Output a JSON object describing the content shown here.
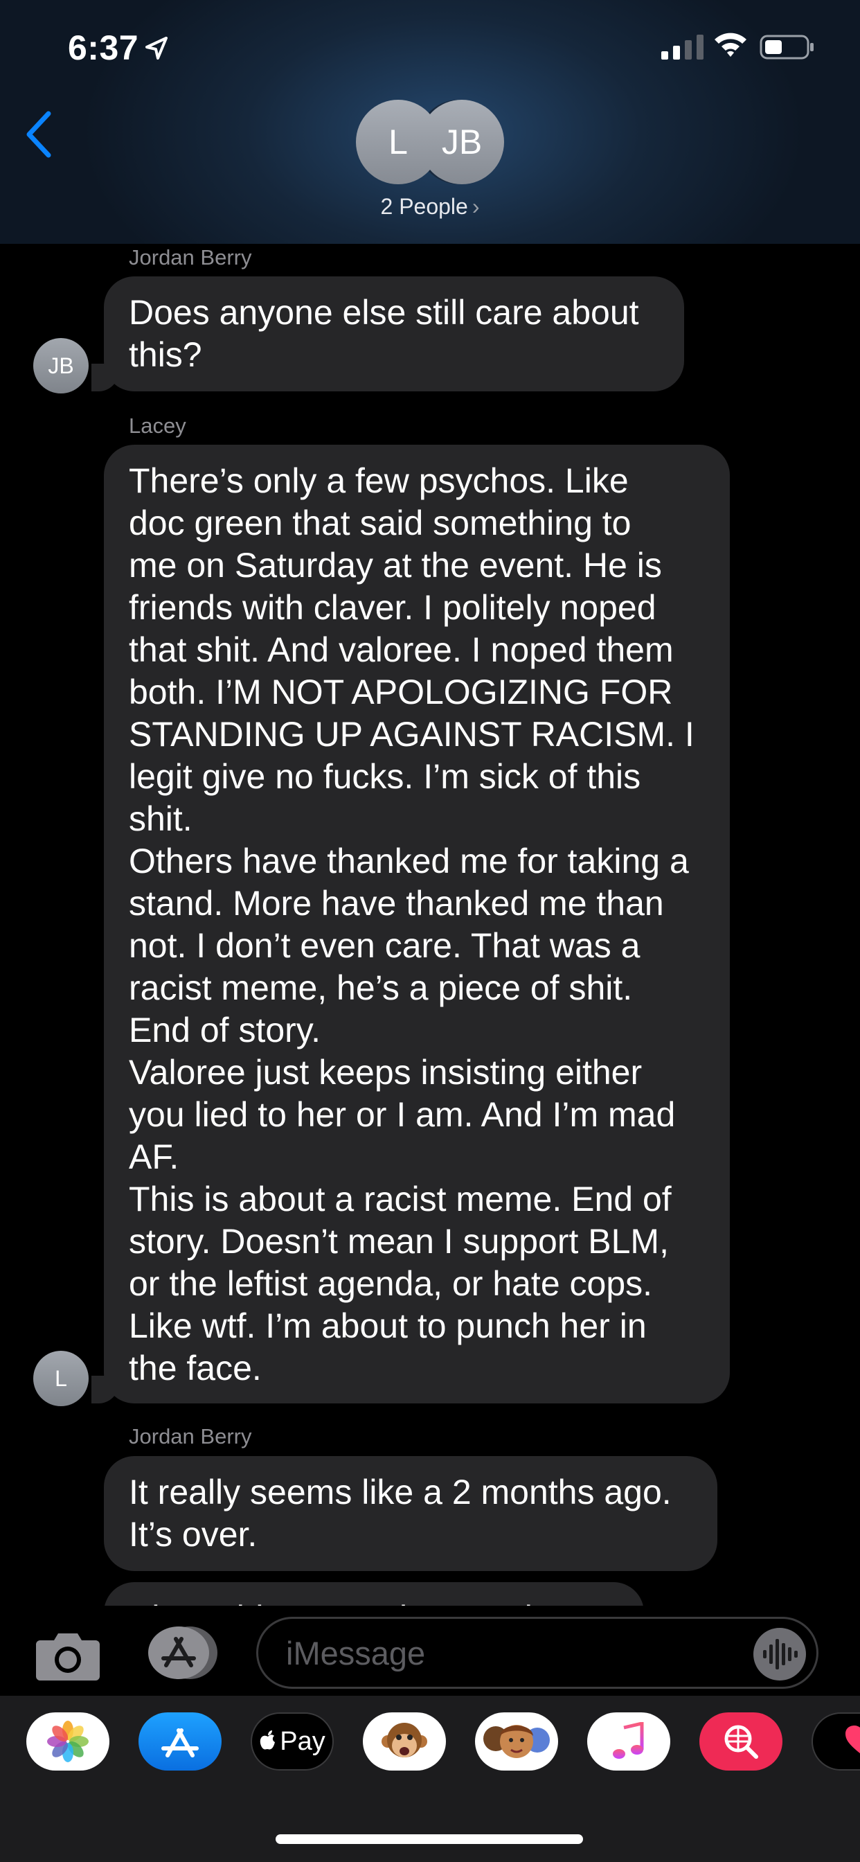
{
  "status_bar": {
    "time": "6:37"
  },
  "header": {
    "avatars": [
      "L",
      "JB"
    ],
    "title": "2 People",
    "chevron": "›"
  },
  "messages": [
    {
      "sender": "Jordan Berry",
      "avatar": "JB",
      "lines": [
        "Does anyone else still care about",
        "this?"
      ]
    },
    {
      "sender": "Lacey",
      "avatar": "L",
      "lines": [
        "There’s only a few psychos. Like",
        "doc green that said something to",
        "me on Saturday at the event. He is",
        "friends with claver. I politely noped",
        "that shit. And valoree. I noped them",
        "both. I’M NOT APOLOGIZING FOR",
        "STANDING UP AGAINST RACISM. I",
        "legit give no fucks. I’m sick of this",
        "shit.",
        "Others have thanked me for taking a",
        "stand. More have thanked me than",
        "not. I don’t even care. That was a",
        "racist meme, he’s a piece of shit.",
        "End of story.",
        "Valoree just keeps insisting either",
        "you lied to her or I am. And I’m mad",
        "AF.",
        "This is about a racist meme. End of",
        "story. Doesn’t mean I support BLM,",
        "or the leftist agenda, or hate cops.",
        "Like wtf. I’m about to punch her in",
        "the face."
      ]
    },
    {
      "sender": "Jordan Berry",
      "lines": [
        "It really seems like a 2 months ago.",
        "It’s over."
      ]
    },
    {
      "partial_text": "Blame him. He’s the one that’s"
    }
  ],
  "input": {
    "placeholder": "iMessage"
  },
  "app_drawer": {
    "apps": [
      "photos-app",
      "app-store-app",
      "apple-pay-app",
      "animoji-app",
      "memoji-app",
      "music-app",
      "web-images-app",
      "digital-touch-app"
    ],
    "apple_pay_label": "Pay"
  },
  "colors": {
    "accent": "#0a84ff",
    "bubble": "#262628",
    "background": "#000000",
    "header": "#15263a"
  }
}
